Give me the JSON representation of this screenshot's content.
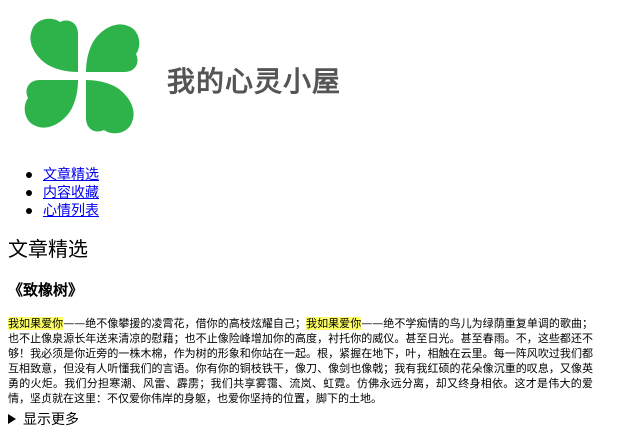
{
  "header": {
    "site_title": "我的心灵小屋",
    "logo_icon": "clover-icon",
    "logo_color": "#2db34a"
  },
  "nav": {
    "items": [
      {
        "label": "文章精选"
      },
      {
        "label": "内容收藏"
      },
      {
        "label": "心情列表"
      }
    ]
  },
  "section": {
    "title": "文章精选"
  },
  "article": {
    "title": "《致橡树》",
    "highlight_phrase": "我如果爱你",
    "highlight_color": "#ffff66",
    "segments": [
      {
        "text": "我如果爱你",
        "highlight": true
      },
      {
        "text": "——绝不像攀援的凌霄花，借你的高枝炫耀自己；",
        "highlight": false
      },
      {
        "text": "我如果爱你",
        "highlight": true
      },
      {
        "text": "——绝不学痴情的鸟儿为绿荫重复单调的歌曲；也不止像泉源长年送来清凉的慰藉；也不止像险峰增加你的高度，衬托你的威仪。甚至日光。甚至春雨。不，这些都还不够！我必须是你近旁的一株木棉，作为树的形象和你站在一起。根，紧握在地下，叶，相触在云里。每一阵风吹过我们都互相致意，但没有人听懂我们的言语。你有你的铜枝铁干，像刀、像剑也像戟；我有我红硕的花朵像沉重的叹息，又像英勇的火炬。我们分担寒潮、风雷、霹雳；我们共享雾霭、流岚、虹霓。仿佛永远分离，却又终身相依。这才是伟大的爱情，坚贞就在这里：不仅爱你伟岸的身躯，也爱你坚持的位置，脚下的土地。",
        "highlight": false
      }
    ]
  },
  "details": {
    "summary_label": "显示更多",
    "expanded": false
  }
}
